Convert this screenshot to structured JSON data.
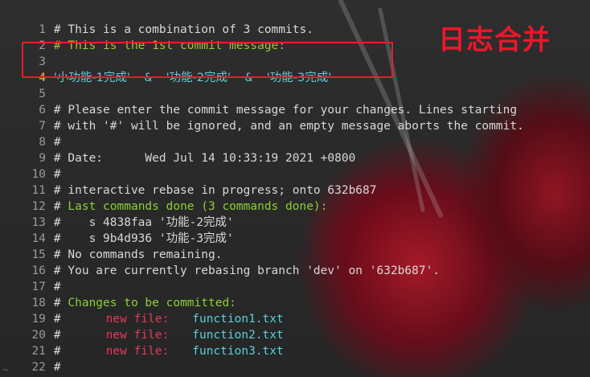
{
  "overlay_title": "日志合并",
  "lines": [
    {
      "n": "1",
      "text": "# This is a combination of 3 commits."
    },
    {
      "n": "2",
      "text": "# This is the 1st commit message:"
    },
    {
      "n": "3",
      "text": ""
    },
    {
      "n": "4",
      "parts": [
        "'小功能-1完成'",
        "&",
        "'功能-2完成'",
        "&",
        "'功能-3完成'"
      ]
    },
    {
      "n": "5",
      "text": ""
    },
    {
      "n": "6",
      "text": "# Please enter the commit message for your changes. Lines starting"
    },
    {
      "n": "7",
      "text": "# with '#' will be ignored, and an empty message aborts the commit."
    },
    {
      "n": "8",
      "text": "#"
    },
    {
      "n": "9",
      "text": "# Date:      Wed Jul 14 10:33:19 2021 +0800"
    },
    {
      "n": "10",
      "text": "#"
    },
    {
      "n": "11",
      "text": "# interactive rebase in progress; onto 632b687"
    },
    {
      "n": "12",
      "hash": "#",
      "text": "Last commands done (3 commands done):"
    },
    {
      "n": "13",
      "text": "#    s 4838faa '功能-2完成'"
    },
    {
      "n": "14",
      "text": "#    s 9b4d936 '功能-3完成'"
    },
    {
      "n": "15",
      "text": "# No commands remaining."
    },
    {
      "n": "16",
      "text": "# You are currently rebasing branch 'dev' on '632b687'."
    },
    {
      "n": "17",
      "text": "#"
    },
    {
      "n": "18",
      "hash": "#",
      "text": "Changes to be committed:"
    },
    {
      "n": "19",
      "hash": "#",
      "label": "new file:",
      "file": "function1.txt"
    },
    {
      "n": "20",
      "hash": "#",
      "label": "new file:",
      "file": "function2.txt"
    },
    {
      "n": "21",
      "hash": "#",
      "label": "new file:",
      "file": "function3.txt"
    },
    {
      "n": "22",
      "text": "#"
    }
  ],
  "eof_marker": "~",
  "colors": {
    "comment": "#d8d8d8",
    "section_heading": "#8ccf3a",
    "commit_message": "#5ad0e0",
    "new_file_label": "#e63a55",
    "filename": "#5ad0e0",
    "annotation_red": "#e8182a"
  }
}
